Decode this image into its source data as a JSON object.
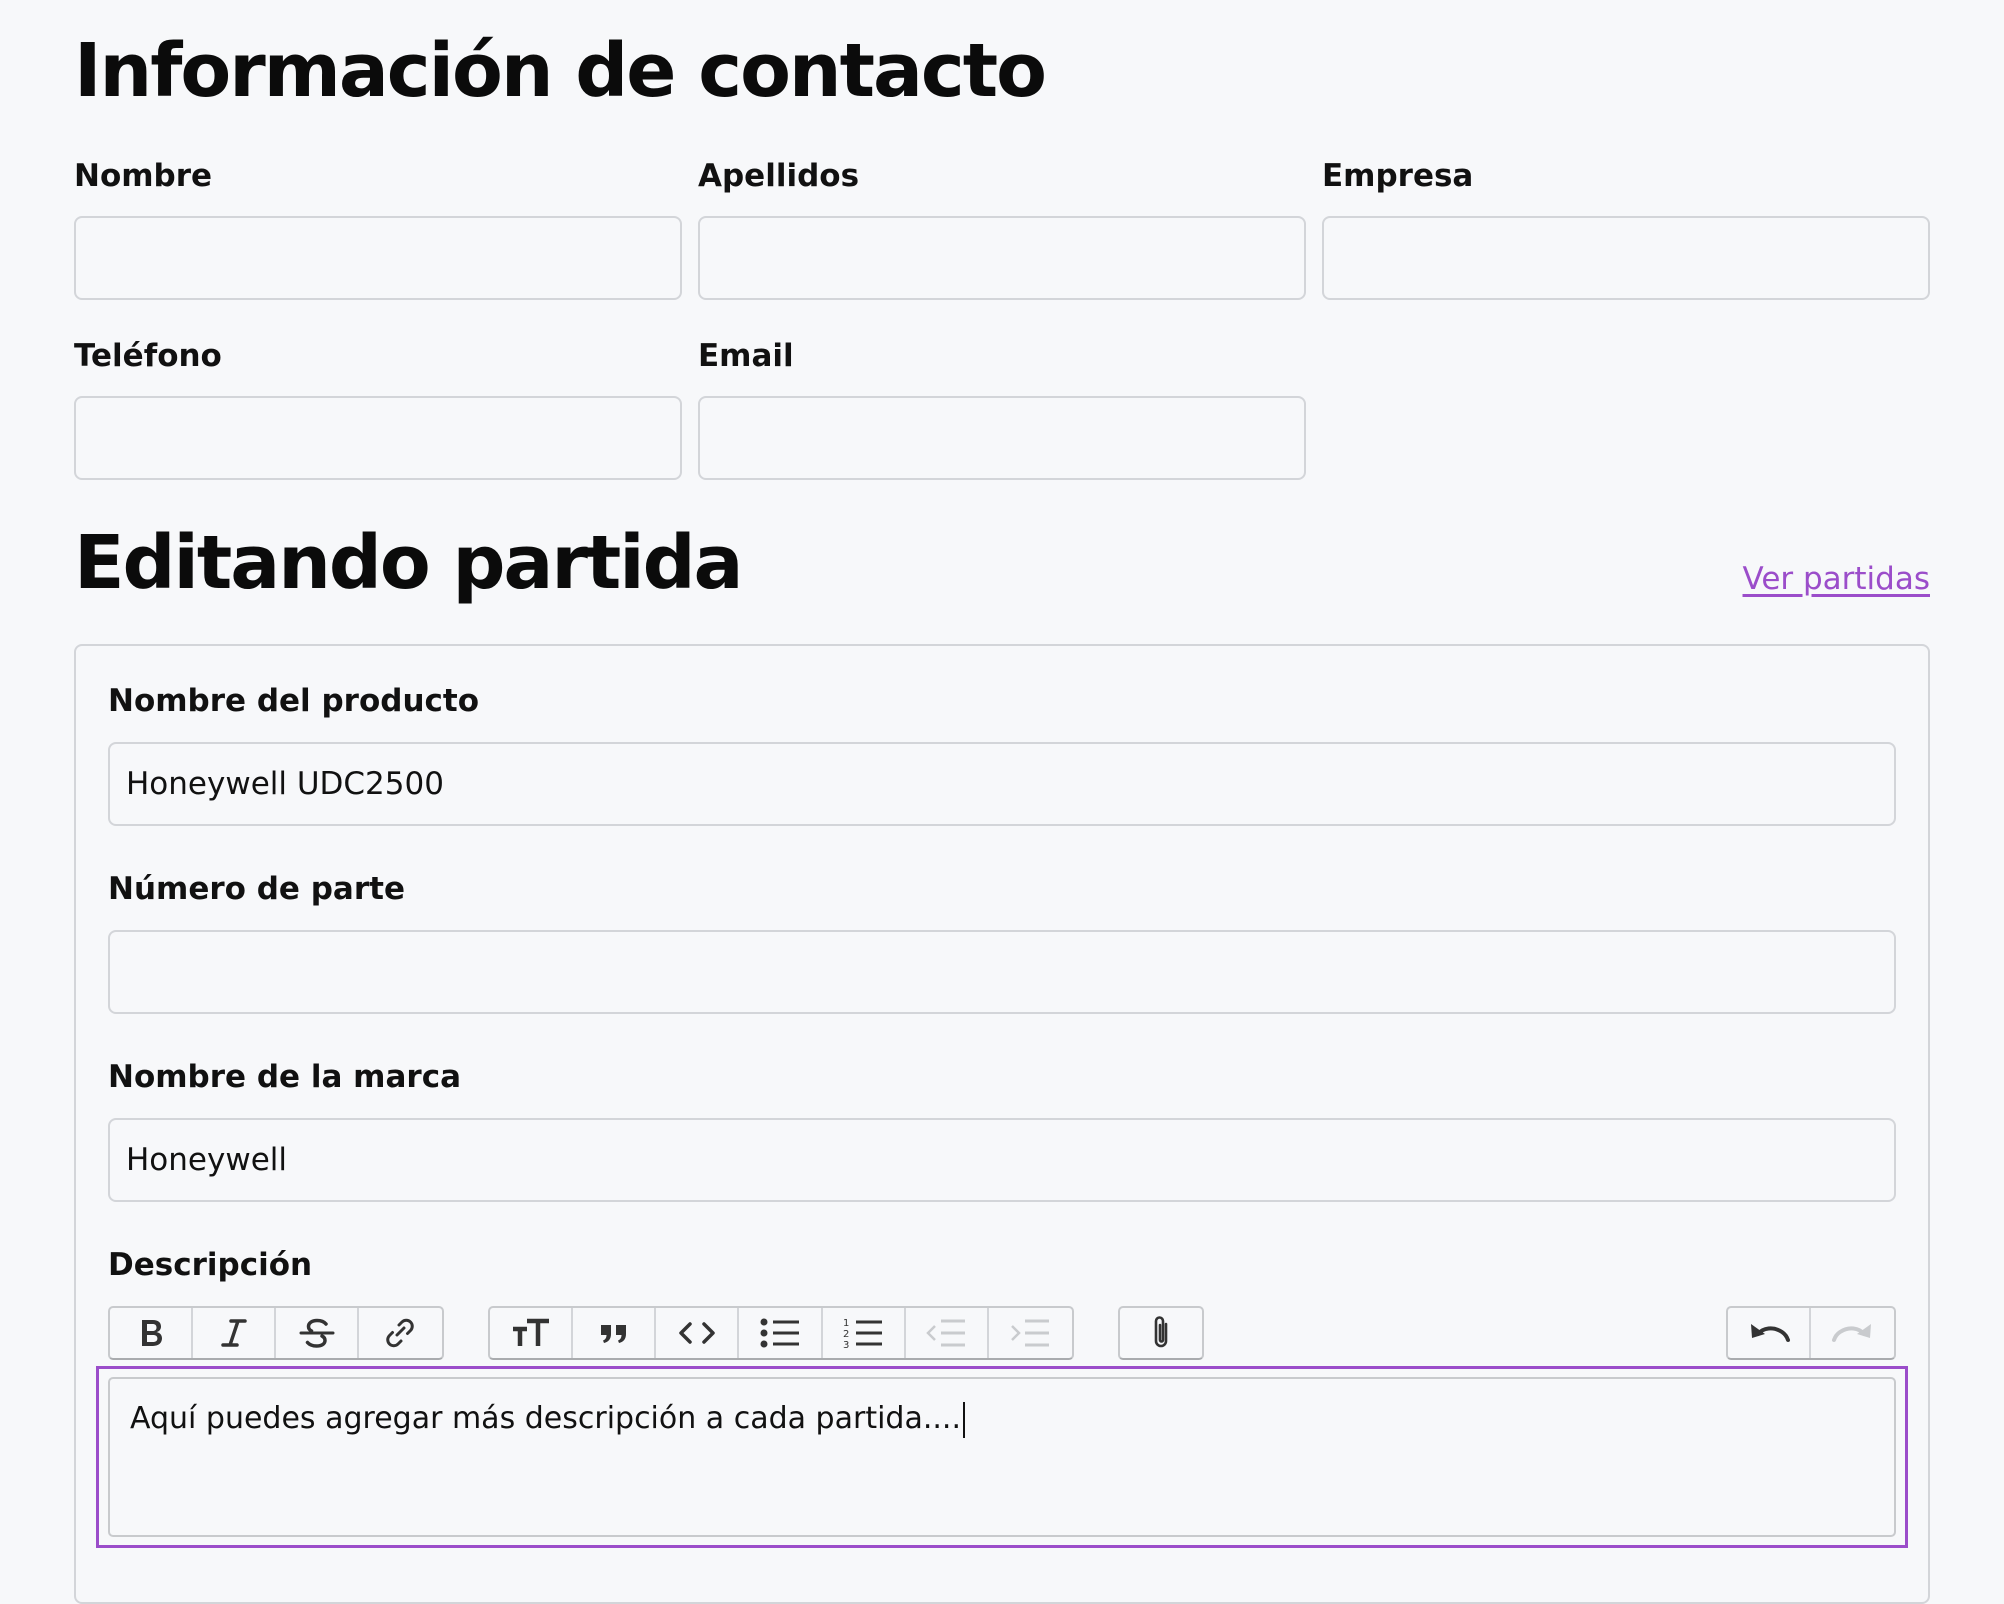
{
  "contact": {
    "title": "Información de contacto",
    "fields": {
      "first_name": {
        "label": "Nombre",
        "value": ""
      },
      "last_name": {
        "label": "Apellidos",
        "value": ""
      },
      "company": {
        "label": "Empresa",
        "value": ""
      },
      "phone": {
        "label": "Teléfono",
        "value": ""
      },
      "email": {
        "label": "Email",
        "value": ""
      }
    }
  },
  "item": {
    "title": "Editando partida",
    "view_link": "Ver partidas",
    "fields": {
      "product_name": {
        "label": "Nombre del producto",
        "value": "Honeywell UDC2500"
      },
      "part_number": {
        "label": "Número de parte",
        "value": ""
      },
      "brand_name": {
        "label": "Nombre de la marca",
        "value": "Honeywell"
      },
      "description": {
        "label": "Descripción",
        "value": "Aquí puedes agregar más descripción a cada partida...."
      }
    },
    "toolbar": {
      "text_tools": [
        "bold-icon",
        "italic-icon",
        "strikethrough-icon",
        "link-icon"
      ],
      "block_tools": [
        "heading-icon",
        "quote-icon",
        "code-icon",
        "bullet-list-icon",
        "numbered-list-icon",
        "decrease-indent-icon",
        "increase-indent-icon"
      ],
      "file_tools": [
        "attach-icon"
      ],
      "history_tools": [
        "undo-icon",
        "redo-icon"
      ]
    }
  },
  "colors": {
    "accent": "#9b4dca",
    "background": "#f7f8fa",
    "border": "#d3d5d9"
  }
}
